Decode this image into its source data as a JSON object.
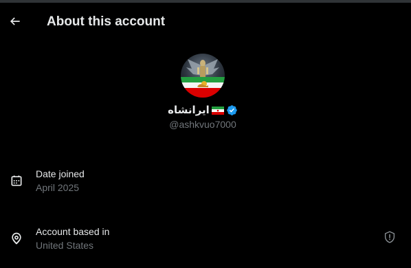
{
  "header": {
    "title": "About this account",
    "back_icon": "arrow-left-icon"
  },
  "profile": {
    "display_name": "ایرانشاه",
    "flag": "iran-flag",
    "verified_icon": "verified-badge-icon",
    "handle": "@ashkvuo7000"
  },
  "details": {
    "date_joined": {
      "icon": "calendar-icon",
      "label": "Date joined",
      "value": "April 2025"
    },
    "account_based_in": {
      "icon": "location-pin-icon",
      "label": "Account based in",
      "value": "United States",
      "trailing_icon": "shield-info-icon"
    }
  },
  "colors": {
    "background": "#000000",
    "primary_text": "#e7e9ea",
    "secondary_text": "#71767b",
    "verified_blue": "#1d9bf0"
  }
}
